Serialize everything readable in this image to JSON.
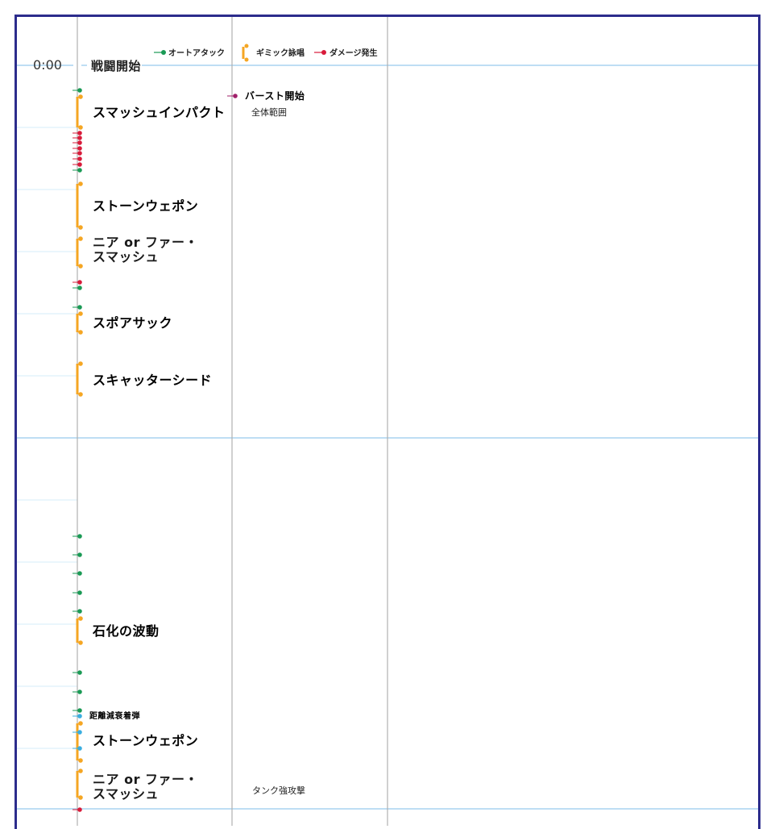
{
  "start": {
    "time": "0:00",
    "label": "戦闘開始"
  },
  "legend": [
    {
      "label": "オートアタック",
      "marker": "dot",
      "color": "#1a9a55"
    },
    {
      "label": "ギミック詠唱",
      "marker": "bracket",
      "color": "#f5a623"
    },
    {
      "label": "ダメージ発生",
      "marker": "dot",
      "color": "#d81b3a"
    }
  ],
  "colors": {
    "frame": "#2c2c8c",
    "major_grid": "#a8d4f0",
    "minor_grid": "#d4ecfa",
    "column_line": "#b0b0b0",
    "auto_attack": "#1a9a55",
    "cast": "#f5a623",
    "damage": "#d81b3a",
    "burst": "#a0206a",
    "proximity": "#3aaee0"
  },
  "main_casts": [
    {
      "name": "スマッシュインパクト"
    },
    {
      "name": "ストーンウェポン"
    },
    {
      "name": "ニア or ファー・スマッシュ"
    },
    {
      "name": "スポアサック"
    },
    {
      "name": "スキャッターシード"
    },
    {
      "name": "石化の波動"
    },
    {
      "name": "ストーンウェポン"
    },
    {
      "name": "ニア or ファー・スマッシュ"
    }
  ],
  "small_note": "距離減衰着弾",
  "side_notes": {
    "burst": "バースト開始",
    "burst_sub": "全体範囲",
    "tankbuster": "タンク強攻撃"
  }
}
